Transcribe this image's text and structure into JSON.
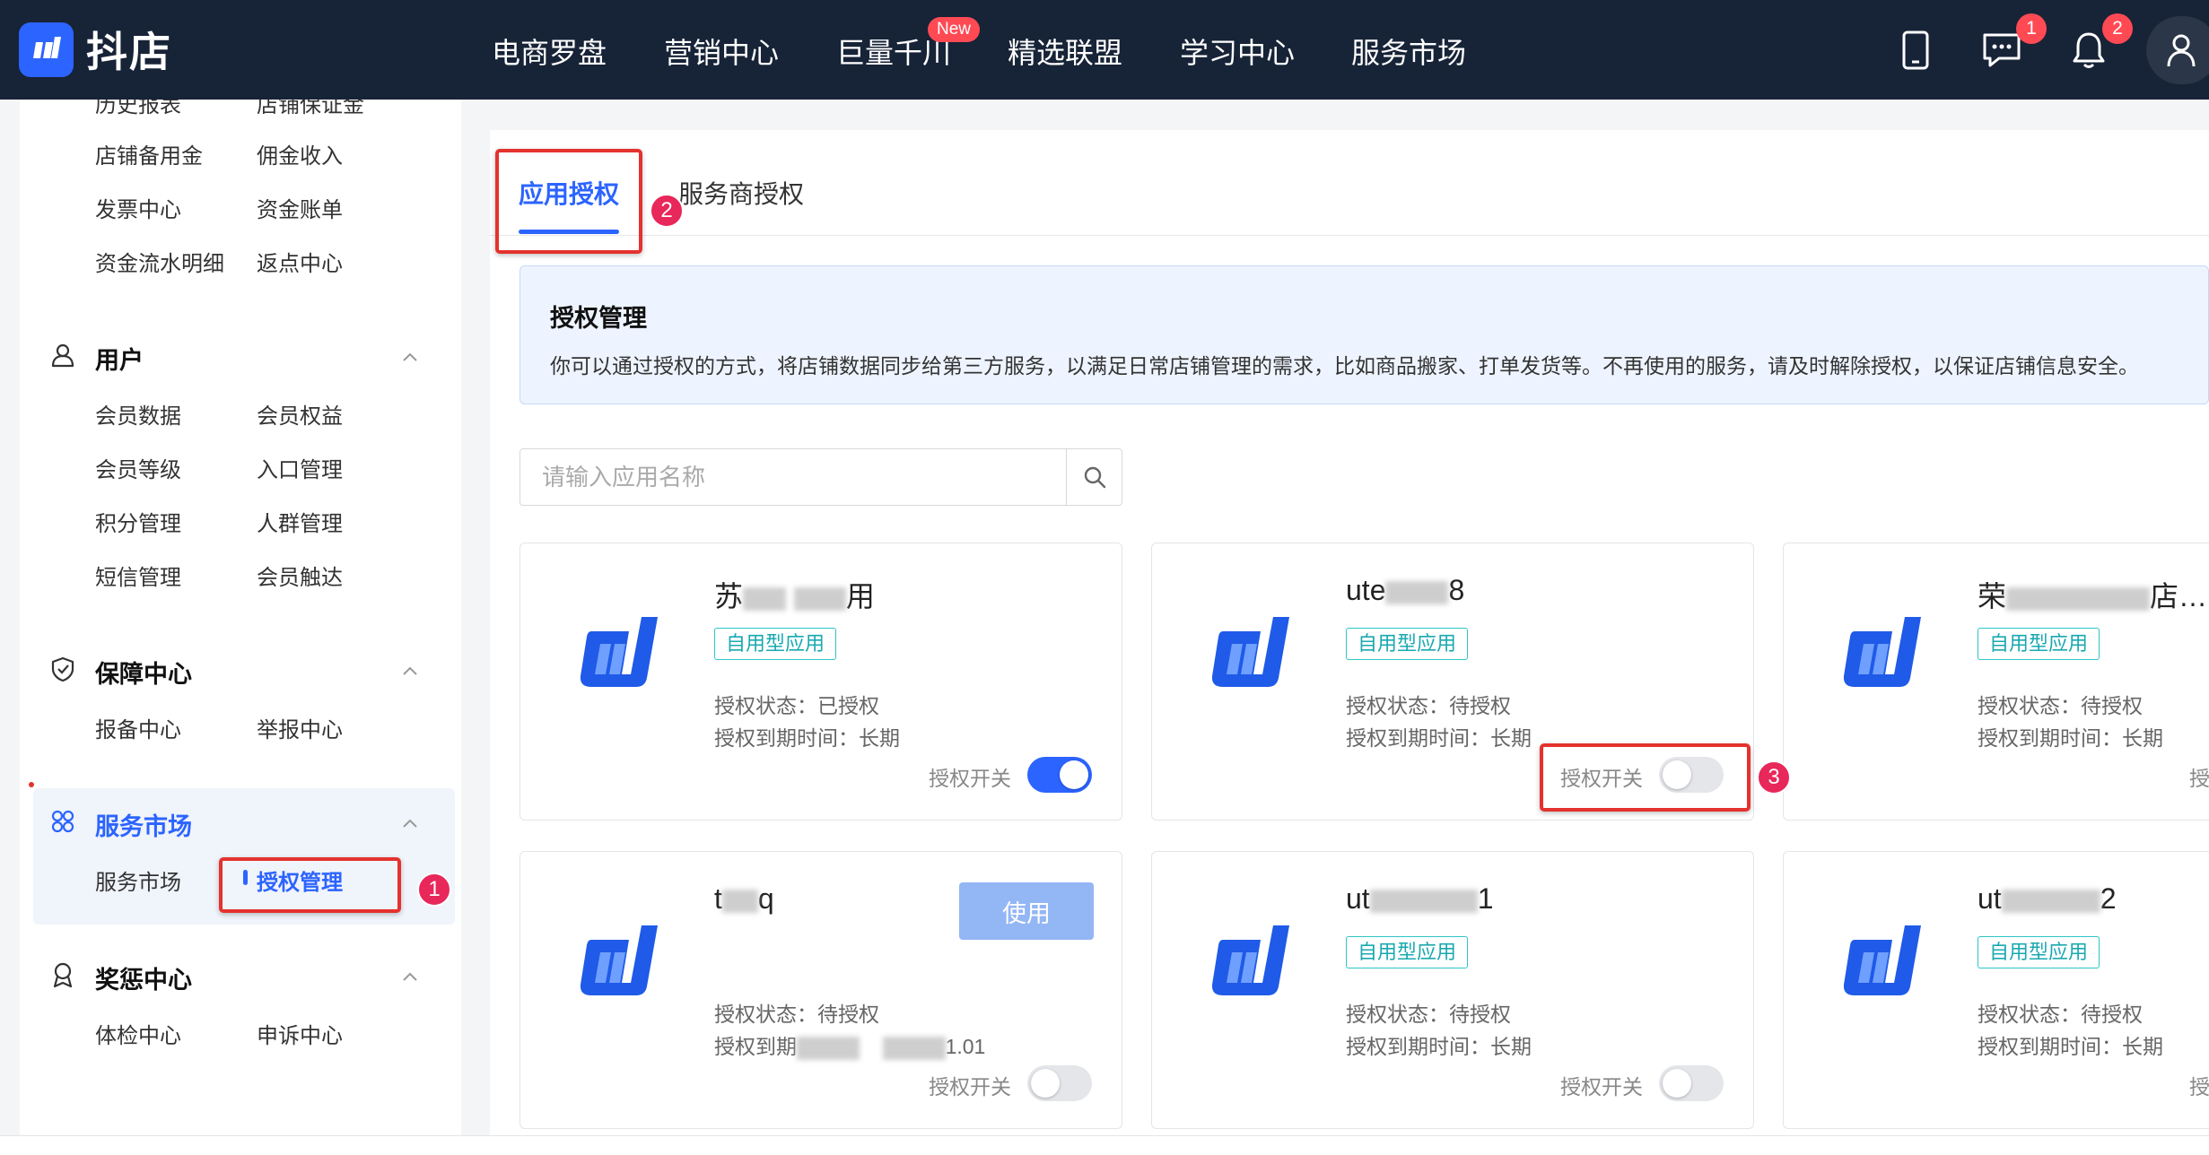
{
  "header": {
    "brand": "抖店",
    "nav": [
      "电商罗盘",
      "营销中心",
      "巨量千川",
      "精选联盟",
      "学习中心",
      "服务市场"
    ],
    "new_badge": "New",
    "chat_badge": "1",
    "bell_badge": "2"
  },
  "sidebar": {
    "top_partial": [
      "历史报表",
      "店铺保证金"
    ],
    "finance_rows": [
      [
        "店铺备用金",
        "佣金收入"
      ],
      [
        "发票中心",
        "资金账单"
      ],
      [
        "资金流水明细",
        "返点中心"
      ]
    ],
    "user_section": {
      "title": "用户",
      "rows": [
        [
          "会员数据",
          "会员权益"
        ],
        [
          "会员等级",
          "入口管理"
        ],
        [
          "积分管理",
          "人群管理"
        ],
        [
          "短信管理",
          "会员触达"
        ]
      ]
    },
    "guarantee_section": {
      "title": "保障中心",
      "rows": [
        [
          "报备中心",
          "举报中心"
        ]
      ]
    },
    "service_section": {
      "title": "服务市场",
      "rows": [
        [
          "服务市场",
          "授权管理"
        ]
      ]
    },
    "reward_section": {
      "title": "奖惩中心",
      "rows": [
        [
          "体检中心",
          "申诉中心"
        ]
      ]
    }
  },
  "tabs": [
    "应用授权",
    "服务商授权"
  ],
  "notice": {
    "title": "授权管理",
    "desc": "你可以通过授权的方式，将店铺数据同步给第三方服务，以满足日常店铺管理的需求，比如商品搬家、打单发货等。不再使用的服务，请及时解除授权，以保证店铺信息安全。"
  },
  "search": {
    "placeholder": "请输入应用名称"
  },
  "cards": [
    {
      "name_a": "苏",
      "name_b": "用",
      "tag": "自用型应用",
      "status": "授权状态：已授权",
      "expire": "授权到期时间：长期",
      "switch_label": "授权开关",
      "switch_on": true
    },
    {
      "name_a": "ute",
      "name_b": "8",
      "tag": "自用型应用",
      "status": "授权状态：待授权",
      "expire": "授权到期时间：长期",
      "switch_label": "授权开关",
      "switch_on": false
    },
    {
      "name_a": "荣",
      "name_b": "店…",
      "tag": "自用型应用",
      "status": "授权状态：待授权",
      "expire": "授权到期时间：长期",
      "switch_label": "授",
      "switch_on": false
    },
    {
      "name_a": "t",
      "name_b": "q",
      "use_button": "使用",
      "status": "授权状态：待授权",
      "expire_a": "授权到期",
      "expire_b": "1.01",
      "switch_label": "授权开关",
      "switch_on": false
    },
    {
      "name_a": "ut",
      "name_b": "1",
      "tag": "自用型应用",
      "status": "授权状态：待授权",
      "expire": "授权到期时间：长期",
      "switch_label": "授权开关",
      "switch_on": false
    },
    {
      "name_a": "ut",
      "name_b": "2",
      "tag": "自用型应用",
      "status": "授权状态：待授权",
      "expire": "授权到期时间：长期",
      "switch_label": "授",
      "switch_on": false
    }
  ],
  "annotations": [
    "1",
    "2",
    "3"
  ],
  "colors": {
    "brand_blue": "#2c64ff",
    "header_bg": "#172337",
    "annotation_red": "#e4322e",
    "annotation_pink": "#e8275a",
    "tag_cyan": "#1aa9b0"
  }
}
